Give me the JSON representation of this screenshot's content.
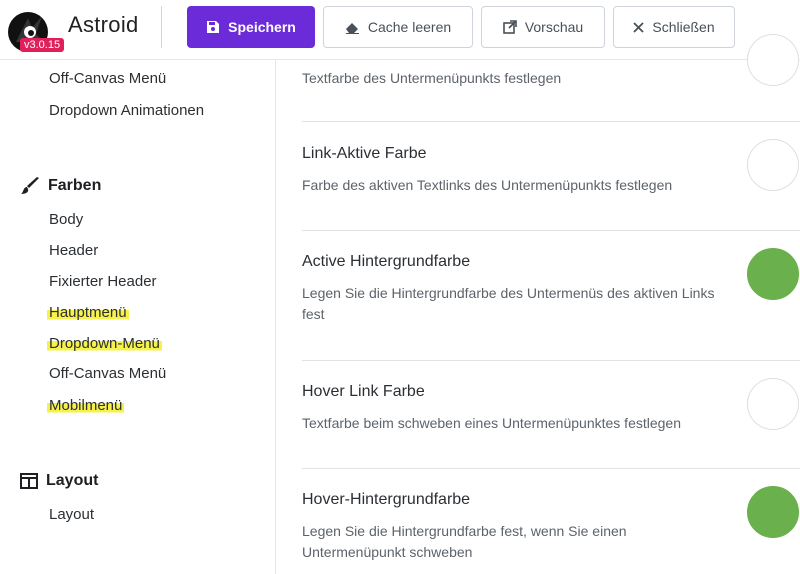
{
  "header": {
    "brand": "Astroid",
    "version": "v3.0.15",
    "buttons": {
      "save": "Speichern",
      "cache": "Cache leeren",
      "preview": "Vorschau",
      "close": "Schließen"
    }
  },
  "sidebar": {
    "items_top": [
      "Off-Canvas Menü",
      "Dropdown Animationen"
    ],
    "group_farben": "Farben",
    "farben_items": [
      "Body",
      "Header",
      "Fixierter Header",
      "Hauptmenü",
      "Dropdown-Menü",
      "Off-Canvas Menü",
      "Mobilmenü"
    ],
    "group_layout": "Layout",
    "layout_items": [
      "Layout"
    ]
  },
  "settings": [
    {
      "title": "",
      "desc": "Textfarbe des Untermenüpunkts festlegen",
      "color": "#ffffff"
    },
    {
      "title": "Link-Aktive Farbe",
      "desc": "Farbe des aktiven Textlinks des Untermenüpunkts festlegen",
      "color": "#ffffff"
    },
    {
      "title": "Active Hintergrundfarbe",
      "desc": "Legen Sie die Hintergrundfarbe des Untermenüs des aktiven Links fest",
      "color": "#6ab04c"
    },
    {
      "title": "Hover Link Farbe",
      "desc": "Textfarbe beim schweben eines Untermenüpunktes festlegen",
      "color": "#ffffff"
    },
    {
      "title": "Hover-Hintergrundfarbe",
      "desc": "Legen Sie die Hintergrundfarbe fest, wenn Sie einen Untermenüpunkt schweben",
      "color": "#6ab04c"
    }
  ],
  "colors": {
    "primary": "#6c2bd9",
    "highlight": "#f7f24a",
    "green": "#6ab04c",
    "badge": "#e0205a"
  }
}
